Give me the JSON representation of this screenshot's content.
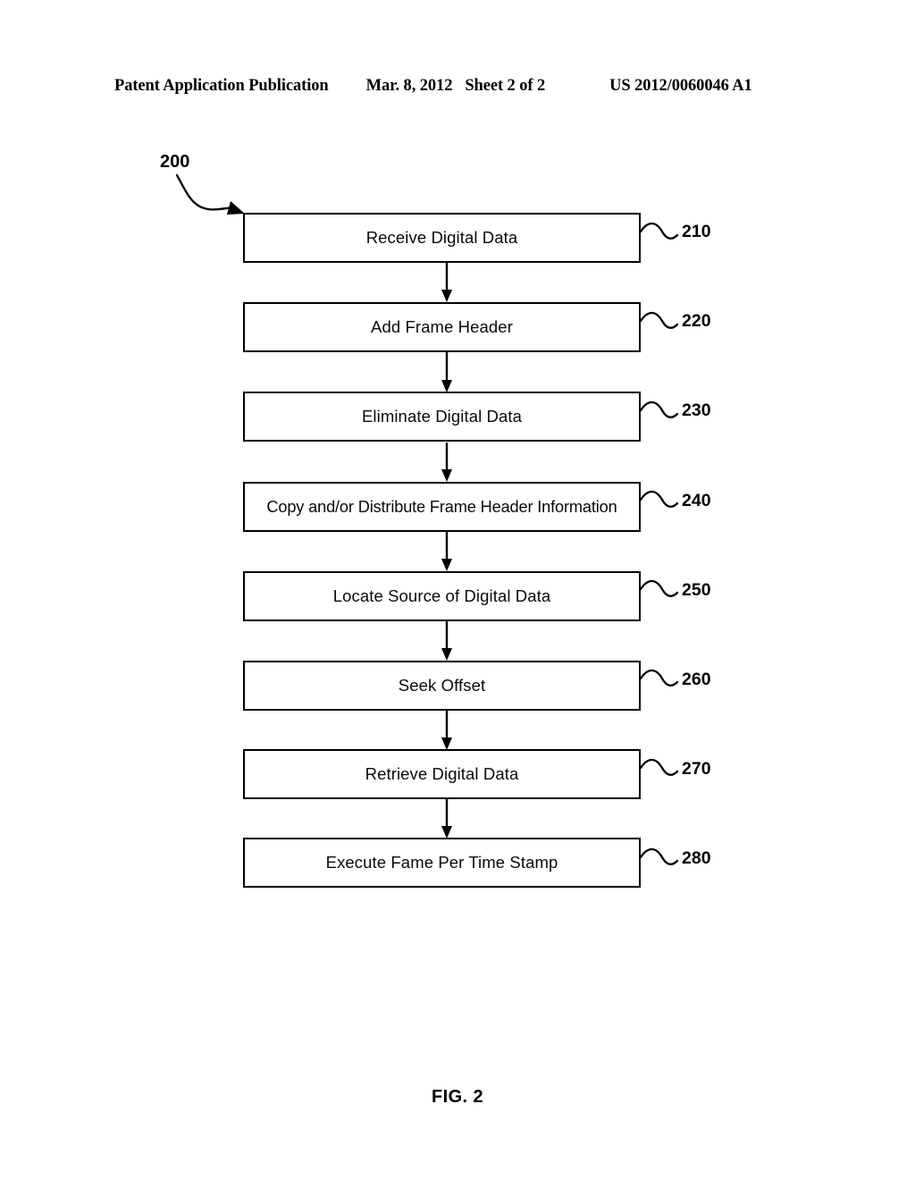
{
  "header": {
    "publication": "Patent Application Publication",
    "date": "Mar. 8, 2012",
    "sheet": "Sheet 2 of 2",
    "patent_number": "US 2012/0060046 A1"
  },
  "figure": {
    "caption": "FIG. 2",
    "diagram_numeral": "200",
    "line_color": "#000000",
    "box_fill": "#ffffff",
    "background": "#ffffff",
    "steps": [
      {
        "label": "Receive Digital Data",
        "ref": "210"
      },
      {
        "label": "Add Frame Header",
        "ref": "220"
      },
      {
        "label": "Eliminate Digital Data",
        "ref": "230"
      },
      {
        "label": "Copy and/or Distribute Frame Header Information",
        "ref": "240"
      },
      {
        "label": "Locate Source of Digital Data",
        "ref": "250"
      },
      {
        "label": "Seek Offset",
        "ref": "260"
      },
      {
        "label": "Retrieve Digital Data",
        "ref": "270"
      },
      {
        "label": "Execute Fame Per Time Stamp",
        "ref": "280"
      }
    ]
  }
}
